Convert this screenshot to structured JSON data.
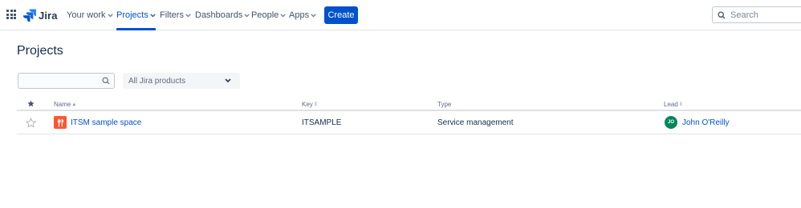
{
  "nav": {
    "logo_text": "Jira",
    "items": [
      {
        "label": "Your work"
      },
      {
        "label": "Projects"
      },
      {
        "label": "Filters"
      },
      {
        "label": "Dashboards"
      },
      {
        "label": "People"
      },
      {
        "label": "Apps"
      }
    ],
    "active_item": "Projects",
    "create_label": "Create",
    "search_placeholder": "Search"
  },
  "page": {
    "title": "Projects",
    "filter": {
      "search_value": "",
      "product_select": "All Jira products"
    }
  },
  "table": {
    "columns": [
      "Name",
      "Key",
      "Type",
      "Lead"
    ],
    "sorted_by": "Name",
    "rows": [
      {
        "starred": false,
        "name": "ITSM sample space",
        "key": "ITSAMPLE",
        "type": "Service management",
        "lead": "John O'Reilly",
        "lead_initials": "JO"
      }
    ]
  },
  "colors": {
    "brand": "#0052cc",
    "project_icon": "#ff5630",
    "lead_avatar": "#00875a"
  }
}
